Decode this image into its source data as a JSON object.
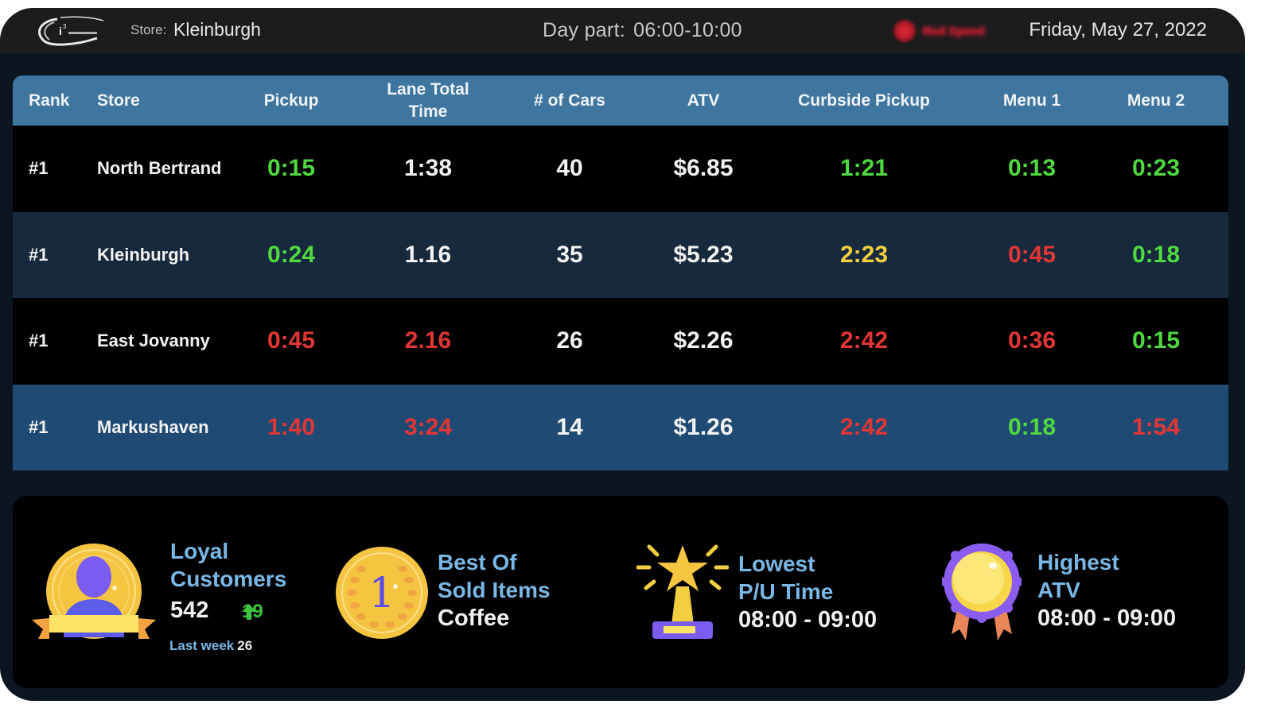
{
  "header": {
    "logo": "i3 International logo",
    "store_label": "Store:",
    "store_name": "Kleinburgh",
    "daypart_label": "Day part:",
    "daypart_value": "06:00-10:00",
    "status_indicator": {
      "icon": "red-alert-dot-icon",
      "text": "Red Speed",
      "color": "#d4202f"
    },
    "date": "Friday, May 27, 2022"
  },
  "table": {
    "columns": [
      "Rank",
      "Store",
      "Pickup",
      "Lane Total Time",
      "# of Cars",
      "ATV",
      "Curbside Pickup",
      "Menu 1",
      "Menu 2"
    ],
    "column_lines": {
      "lane_line1": "Lane Total",
      "lane_line2": "Time"
    },
    "rows": [
      {
        "rank": "#1",
        "store": "North Bertrand",
        "pickup": "0:15",
        "lane": "1:38",
        "cars": "40",
        "atv": "$6.85",
        "curb": "1:21",
        "m1": "0:13",
        "m2": "0:23",
        "status": {
          "pickup": "green",
          "lane": "white",
          "curb": "green",
          "m1": "green",
          "m2": "green"
        }
      },
      {
        "rank": "#1",
        "store": "Kleinburgh",
        "pickup": "0:24",
        "lane": "1.16",
        "cars": "35",
        "atv": "$5.23",
        "curb": "2:23",
        "m1": "0:45",
        "m2": "0:18",
        "status": {
          "pickup": "green",
          "lane": "white",
          "curb": "yellow",
          "m1": "red",
          "m2": "green"
        }
      },
      {
        "rank": "#1",
        "store": "East Jovanny",
        "pickup": "0:45",
        "lane": "2.16",
        "cars": "26",
        "atv": "$2.26",
        "curb": "2:42",
        "m1": "0:36",
        "m2": "0:15",
        "status": {
          "pickup": "red",
          "lane": "red",
          "curb": "red",
          "m1": "red",
          "m2": "green"
        }
      },
      {
        "rank": "#1",
        "store": "Markushaven",
        "pickup": "1:40",
        "lane": "3:24",
        "cars": "14",
        "atv": "$1.26",
        "curb": "2:42",
        "m1": "0:18",
        "m2": "1:54",
        "status": {
          "pickup": "red",
          "lane": "red",
          "curb": "red",
          "m1": "green",
          "m2": "red"
        }
      }
    ]
  },
  "stats": {
    "loyal": {
      "icon": "loyal-customer-medal-icon",
      "title1": "Loyal",
      "title2": "Customers",
      "value": "542",
      "change": "19",
      "change_icon": "arrow-up-icon",
      "last_week_label": "Last week",
      "last_week_value": "26"
    },
    "best_sold": {
      "icon": "gold-coin-number-one-icon",
      "title1": "Best Of",
      "title2": "Sold Items",
      "value": "Coffee"
    },
    "lowest_pu": {
      "icon": "star-trophy-icon",
      "title1": "Lowest",
      "title2": "P/U Time",
      "value": "08:00 - 09:00"
    },
    "highest_atv": {
      "icon": "award-ribbon-icon",
      "title1": "Highest",
      "title2": "ATV",
      "value": "08:00 - 09:00"
    }
  },
  "colors": {
    "good": "#4fd83f",
    "warn": "#f2cf3e",
    "bad": "#e23636",
    "header_bg": "#3f76a0",
    "title_blue": "#79b8e6"
  }
}
